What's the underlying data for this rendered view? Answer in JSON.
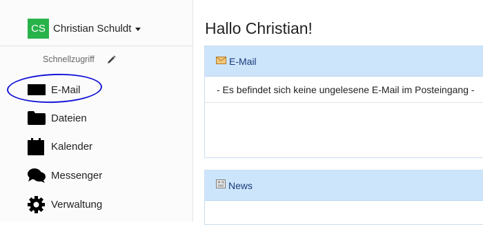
{
  "user": {
    "initials": "CS",
    "name": "Christian Schuldt"
  },
  "sidebar": {
    "quick_access_label": "Schnellzugriff",
    "items": [
      {
        "label": "E-Mail",
        "icon": "envelope-icon"
      },
      {
        "label": "Dateien",
        "icon": "folder-icon"
      },
      {
        "label": "Kalender",
        "icon": "calendar-icon"
      },
      {
        "label": "Messenger",
        "icon": "chat-icon"
      },
      {
        "label": "Verwaltung",
        "icon": "gear-icon"
      }
    ]
  },
  "main": {
    "greeting": "Hallo Christian!",
    "mail_panel": {
      "title": "E-Mail",
      "message": "- Es befindet sich keine ungelesene E-Mail im Posteingang -"
    },
    "news_panel": {
      "title": "News"
    }
  },
  "colors": {
    "avatar": "#27b34a",
    "panel_header": "#cde5fb",
    "annotation": "#1414d8"
  }
}
